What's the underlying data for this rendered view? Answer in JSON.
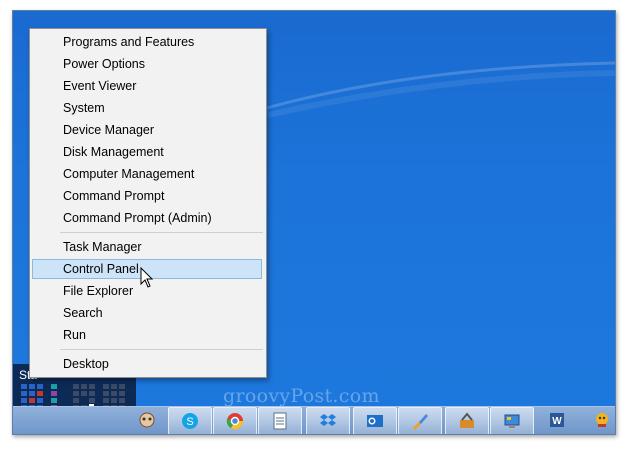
{
  "menu": {
    "group1": [
      "Programs and Features",
      "Power Options",
      "Event Viewer",
      "System",
      "Device Manager",
      "Disk Management",
      "Computer Management",
      "Command Prompt",
      "Command Prompt (Admin)"
    ],
    "group2": [
      "Task Manager",
      "Control Panel",
      "File Explorer",
      "Search",
      "Run"
    ],
    "group3": [
      "Desktop"
    ],
    "hovered_item": "Control Panel"
  },
  "start": {
    "label": "Sta"
  },
  "watermark": "groovyPost.com",
  "taskbar": {
    "buttons": [
      "app-icon",
      "skype-icon",
      "chrome-icon",
      "document-icon",
      "dropbox-icon",
      "outlook-icon",
      "paint-icon",
      "tools-icon",
      "control-panel-icon",
      "word-icon",
      "messenger-icon"
    ]
  },
  "colors": {
    "desktop": "#1b6fd3",
    "menu_bg": "#f2f2f2",
    "hover_bg": "#cde3f7",
    "start_tile": "#0d2a57"
  }
}
